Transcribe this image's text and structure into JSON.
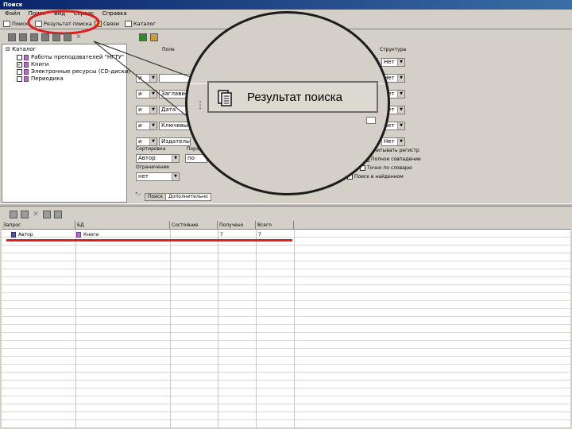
{
  "window": {
    "title": "Поиск"
  },
  "menu": [
    "Файл",
    "Поиск",
    "Вид",
    "Сервис",
    "Справка"
  ],
  "main_tabs": [
    {
      "label": "Поиск"
    },
    {
      "label": "Результат поиска"
    },
    {
      "label": "Связи"
    },
    {
      "label": "Каталог"
    }
  ],
  "tree": {
    "root": "Каталог",
    "items": [
      {
        "label": "Работы преподавателей \"НГТУ\"",
        "checked": false
      },
      {
        "label": "Книги",
        "checked": true
      },
      {
        "label": "Электронные ресурсы (CD-диски)",
        "checked": false
      },
      {
        "label": "Периодика",
        "checked": false
      }
    ]
  },
  "search_form": {
    "col_headers": {
      "field": "Поле",
      "structure": "Структура"
    },
    "rows": [
      {
        "op": "",
        "field": "",
        "struct": "Нет"
      },
      {
        "op": "и",
        "field": "",
        "struct": "Нет"
      },
      {
        "op": "и",
        "field": "Заглавие",
        "struct": "Нет"
      },
      {
        "op": "и",
        "field": "Дата издания",
        "struct": "Нет"
      },
      {
        "op": "и",
        "field": "Ключевые слова",
        "struct": "Нет"
      },
      {
        "op": "и",
        "field": "Издательство",
        "struct": "Нет"
      }
    ],
    "sort_label": "Сортировка",
    "sort_value": "Автор",
    "order_label": "Порядок",
    "order_value": "по возр",
    "limit_label": "Ограничение",
    "limit_value": "нет",
    "options": [
      "Учитывать регистр",
      "Полное совпадение",
      "Точно по словарю",
      "Поиск в найденном"
    ],
    "bottom_tabs": [
      "Поиск",
      "Дополнительно"
    ]
  },
  "magnifier": {
    "label": "Результат поиска"
  },
  "results": {
    "columns": [
      "Запрос",
      "БД",
      "Состояние",
      "Получено",
      "Всего"
    ],
    "rows": [
      {
        "query": "Автор",
        "db": "Книги",
        "state": "",
        "received": "7",
        "total": "7"
      }
    ]
  },
  "colors": {
    "highlight_red": "#e01e1e",
    "window_bg": "#d4d0c8",
    "title_blue": "#0a246a"
  }
}
